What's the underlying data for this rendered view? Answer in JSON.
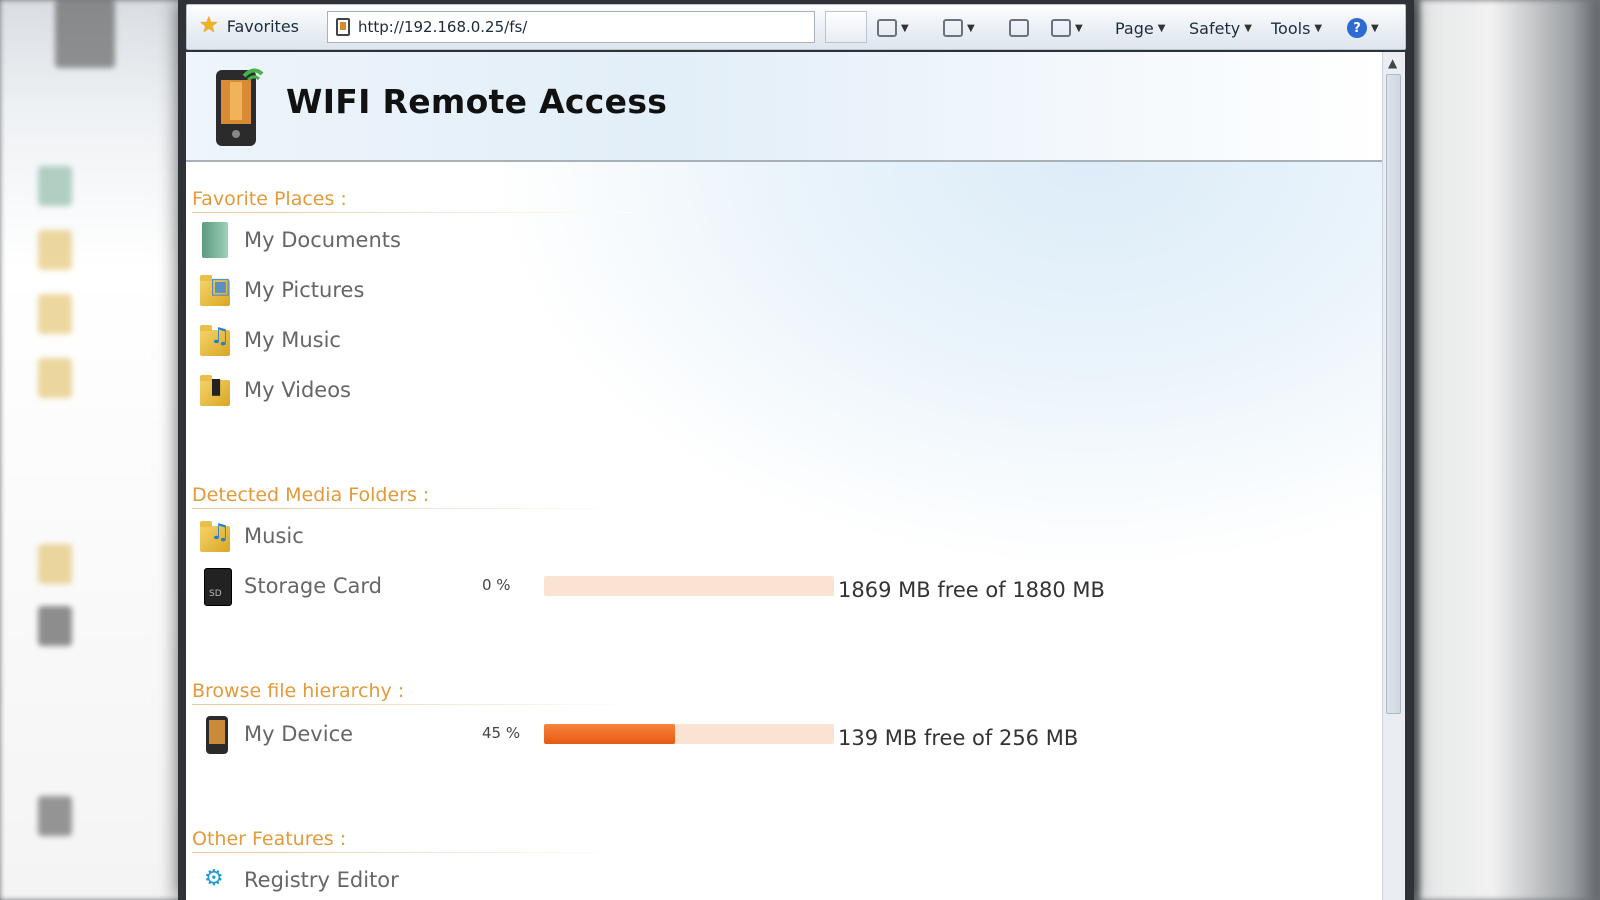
{
  "toolbar": {
    "favorites_label": "Favorites",
    "address": "http://192.168.0.25/fs/",
    "page_label": "Page",
    "safety_label": "Safety",
    "tools_label": "Tools"
  },
  "header": {
    "title": "WIFI Remote Access"
  },
  "favorite_places": {
    "heading": "Favorite Places :",
    "items": [
      {
        "label": "My Documents",
        "icon": "documents-icon"
      },
      {
        "label": "My Pictures",
        "icon": "pictures-folder-icon"
      },
      {
        "label": "My Music",
        "icon": "music-folder-icon"
      },
      {
        "label": "My Videos",
        "icon": "videos-folder-icon"
      }
    ]
  },
  "media_folders": {
    "heading": "Detected Media Folders :",
    "items": [
      {
        "label": "Music",
        "icon": "music-folder-icon"
      },
      {
        "label": "Storage Card",
        "icon": "sd-card-icon",
        "percent_text": "0 %",
        "used_fraction": 0.0,
        "free_text": "1869 MB free of 1880 MB"
      }
    ]
  },
  "file_hierarchy": {
    "heading": "Browse file hierarchy :",
    "items": [
      {
        "label": "My Device",
        "icon": "phone-icon",
        "percent_text": "45 %",
        "used_fraction": 0.45,
        "free_text": "139 MB free of 256 MB"
      }
    ]
  },
  "other_features": {
    "heading": "Other Features :",
    "items": [
      {
        "label": "Registry Editor",
        "icon": "registry-icon"
      }
    ]
  },
  "colors": {
    "section_heading": "#e39a3a",
    "bar_fill": "#e65a12",
    "bar_track": "#fbe3d4"
  }
}
